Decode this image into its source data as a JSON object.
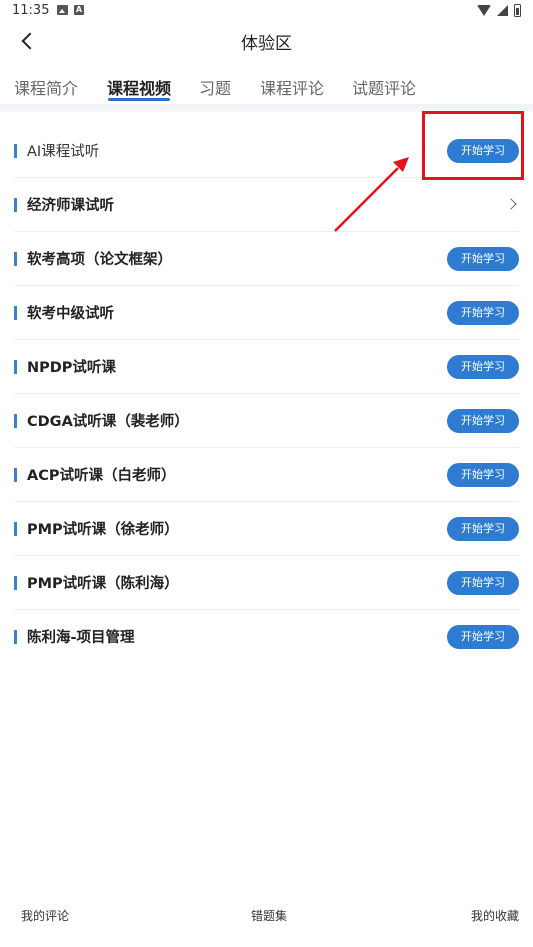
{
  "status_bar": {
    "time": "11:35",
    "a_badge": "A"
  },
  "header": {
    "title": "体验区"
  },
  "tabs": [
    {
      "label": "课程简介"
    },
    {
      "label": "课程视频"
    },
    {
      "label": "习题"
    },
    {
      "label": "课程评论"
    },
    {
      "label": "试题评论"
    }
  ],
  "active_tab": "课程视频",
  "list": {
    "start_label": "开始学习",
    "items": [
      {
        "title": "AI课程试听"
      },
      {
        "title": "经济师课试听"
      },
      {
        "title": "软考高项（论文框架）"
      },
      {
        "title": "软考中级试听"
      },
      {
        "title": "NPDP试听课"
      },
      {
        "title": "CDGA试听课（裴老师）"
      },
      {
        "title": "ACP试听课（白老师）"
      },
      {
        "title": "PMP试听课（徐老师）"
      },
      {
        "title": "PMP试听课（陈利海）"
      },
      {
        "title": "陈利海-项目管理"
      }
    ]
  },
  "bottom_bar": {
    "comments": "我的评论",
    "wrong_set": "错题集",
    "favorites": "我的收藏"
  },
  "colors": {
    "accent": "#2e7bd1",
    "tab_underline": "#2e6fd0",
    "annotation": "#e3131b"
  }
}
